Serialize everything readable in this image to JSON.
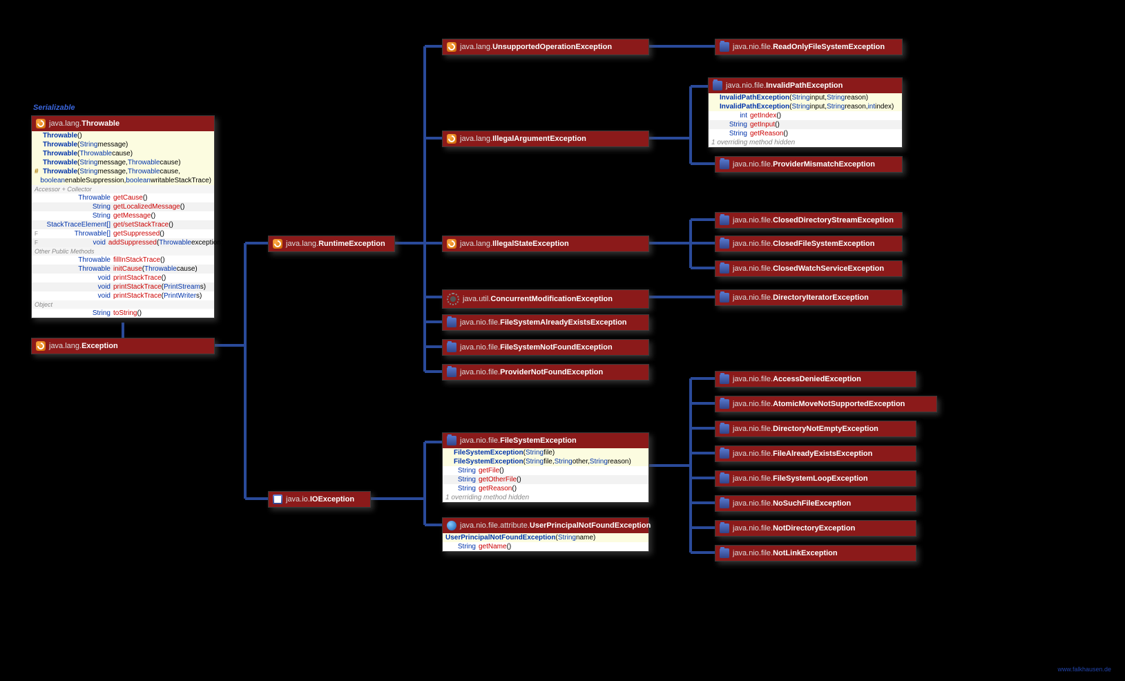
{
  "interfaceLabel": "Serializable",
  "footer": "www.falkhausen.de",
  "throwable": {
    "pkg": "java.lang.",
    "cls": "Throwable",
    "ctors": [
      {
        "name": "Throwable",
        "params": "()"
      },
      {
        "name": "Throwable",
        "params": "(String message)"
      },
      {
        "name": "Throwable",
        "params": "(Throwable cause)"
      },
      {
        "name": "Throwable",
        "params": "(String message, Throwable cause)"
      },
      {
        "prefix": "#",
        "name": "Throwable",
        "params": "(String message, Throwable cause,"
      },
      {
        "prefix": "",
        "name": "",
        "params": "boolean enableSuppression, boolean writableStackTrace)"
      }
    ],
    "sect1": "Accessor + Collector",
    "accessors": [
      {
        "ret": "Throwable",
        "m": "getCause",
        "p": "()"
      },
      {
        "ret": "String",
        "m": "getLocalizedMessage",
        "p": "()"
      },
      {
        "ret": "String",
        "m": "getMessage",
        "p": "()"
      },
      {
        "ret": "StackTraceElement[]",
        "m": "get/setStackTrace",
        "p": "()"
      },
      {
        "ret": "Throwable[]",
        "m": "getSuppressed",
        "p": "()",
        "f": "F"
      },
      {
        "ret": "void",
        "m": "addSuppressed",
        "p": "(Throwable exception)",
        "f": "F"
      }
    ],
    "sect2": "Other Public Methods",
    "others": [
      {
        "ret": "Throwable",
        "m": "fillInStackTrace",
        "p": "()"
      },
      {
        "ret": "Throwable",
        "m": "initCause",
        "p": "(Throwable cause)"
      },
      {
        "ret": "void",
        "m": "printStackTrace",
        "p": "()"
      },
      {
        "ret": "void",
        "m": "printStackTrace",
        "p": "(PrintStream s)"
      },
      {
        "ret": "void",
        "m": "printStackTrace",
        "p": "(PrintWriter s)"
      }
    ],
    "sect3": "Object",
    "obj": [
      {
        "ret": "String",
        "m": "toString",
        "p": "()"
      }
    ]
  },
  "exception": {
    "pkg": "java.lang.",
    "cls": "Exception"
  },
  "runtime": {
    "pkg": "java.lang.",
    "cls": "RuntimeException"
  },
  "ioexception": {
    "pkg": "java.io.",
    "cls": "IOException"
  },
  "col3": {
    "uoe": {
      "pkg": "java.lang.",
      "cls": "UnsupportedOperationException"
    },
    "iae": {
      "pkg": "java.lang.",
      "cls": "IllegalArgumentException"
    },
    "ise": {
      "pkg": "java.lang.",
      "cls": "IllegalStateException"
    },
    "cme": {
      "pkg": "java.util.",
      "cls": "ConcurrentModificationException"
    },
    "fsaee": {
      "pkg": "java.nio.file.",
      "cls": "FileSystemAlreadyExistsException"
    },
    "fsnfe": {
      "pkg": "java.nio.file.",
      "cls": "FileSystemNotFoundException"
    },
    "pnfe": {
      "pkg": "java.nio.file.",
      "cls": "ProviderNotFoundException"
    }
  },
  "fse": {
    "pkg": "java.nio.file.",
    "cls": "FileSystemException",
    "ctors": [
      {
        "name": "FileSystemException",
        "params": "(String file)"
      },
      {
        "name": "FileSystemException",
        "params": "(String file, String other, String reason)"
      }
    ],
    "methods": [
      {
        "ret": "String",
        "m": "getFile",
        "p": "()"
      },
      {
        "ret": "String",
        "m": "getOtherFile",
        "p": "()"
      },
      {
        "ret": "String",
        "m": "getReason",
        "p": "()"
      }
    ],
    "note": "1 overriding method hidden"
  },
  "upnfe": {
    "pkg": "java.nio.file.attribute.",
    "cls": "UserPrincipalNotFoundException",
    "ctor": {
      "name": "UserPrincipalNotFoundException",
      "params": "(String name)"
    },
    "method": {
      "ret": "String",
      "m": "getName",
      "p": "()"
    }
  },
  "col4": {
    "rofse": {
      "pkg": "java.nio.file.",
      "cls": "ReadOnlyFileSystemException"
    },
    "ipe": {
      "pkg": "java.nio.file.",
      "cls": "InvalidPathException",
      "ctors": [
        {
          "name": "InvalidPathException",
          "params": "(String input, String reason)"
        },
        {
          "name": "InvalidPathException",
          "params": "(String input, String reason, int index)"
        }
      ],
      "methods": [
        {
          "ret": "int",
          "m": "getIndex",
          "p": "()"
        },
        {
          "ret": "String",
          "m": "getInput",
          "p": "()"
        },
        {
          "ret": "String",
          "m": "getReason",
          "p": "()"
        }
      ],
      "note": "1 overriding method hidden"
    },
    "pme": {
      "pkg": "java.nio.file.",
      "cls": "ProviderMismatchException"
    },
    "cdse": {
      "pkg": "java.nio.file.",
      "cls": "ClosedDirectoryStreamException"
    },
    "cfse": {
      "pkg": "java.nio.file.",
      "cls": "ClosedFileSystemException"
    },
    "cwse": {
      "pkg": "java.nio.file.",
      "cls": "ClosedWatchServiceException"
    },
    "die": {
      "pkg": "java.nio.file.",
      "cls": "DirectoryIteratorException"
    },
    "ade": {
      "pkg": "java.nio.file.",
      "cls": "AccessDeniedException"
    },
    "amnse": {
      "pkg": "java.nio.file.",
      "cls": "AtomicMoveNotSupportedException"
    },
    "dnee": {
      "pkg": "java.nio.file.",
      "cls": "DirectoryNotEmptyException"
    },
    "faee": {
      "pkg": "java.nio.file.",
      "cls": "FileAlreadyExistsException"
    },
    "fsle": {
      "pkg": "java.nio.file.",
      "cls": "FileSystemLoopException"
    },
    "nsfe": {
      "pkg": "java.nio.file.",
      "cls": "NoSuchFileException"
    },
    "nde": {
      "pkg": "java.nio.file.",
      "cls": "NotDirectoryException"
    },
    "nle": {
      "pkg": "java.nio.file.",
      "cls": "NotLinkException"
    }
  }
}
